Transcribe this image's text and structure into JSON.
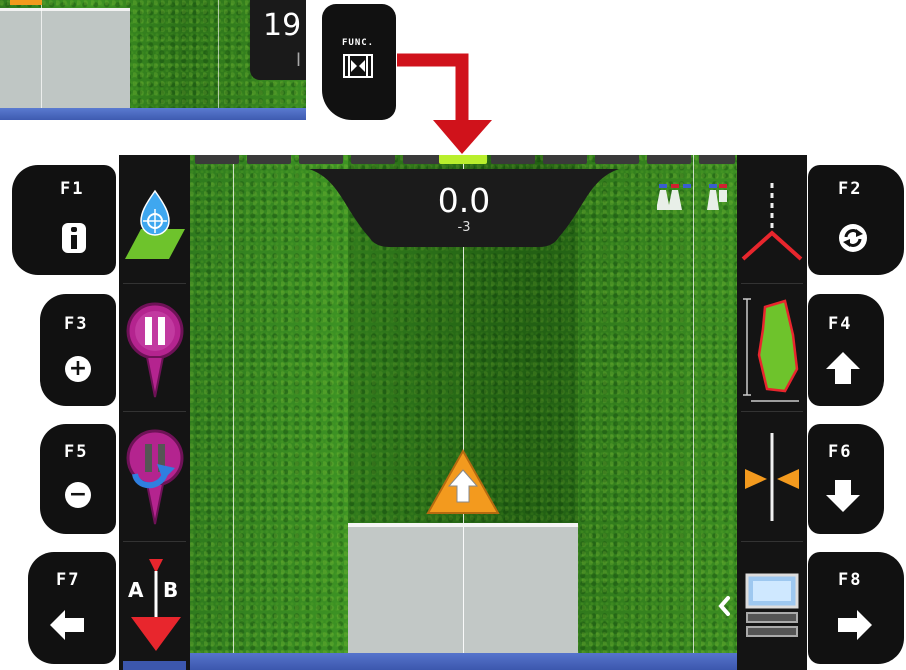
{
  "inset": {
    "counter_value": "19",
    "counter_sub": "l"
  },
  "func_key": {
    "label": "FUNC."
  },
  "guidance": {
    "offset": "0.0",
    "deviation": "-3"
  },
  "fkeys": {
    "f1": "F1",
    "f2": "F2",
    "f3": "F3",
    "f4": "F4",
    "f5": "F5",
    "f6": "F6",
    "f7": "F7",
    "f8": "F8"
  },
  "ab": {
    "a": "A",
    "b": "B"
  },
  "colors": {
    "arrow": "#d0121b",
    "marker_pink": "#b4248f",
    "tractor_orange": "#f39a1e"
  },
  "icons": {
    "f1": "info-icon",
    "f2": "refresh-icon",
    "f3": "plus-icon",
    "f4": "arrow-up-icon",
    "f5": "minus-icon",
    "f6": "arrow-down-icon",
    "f7": "arrow-left-icon",
    "f8": "arrow-right-icon"
  }
}
